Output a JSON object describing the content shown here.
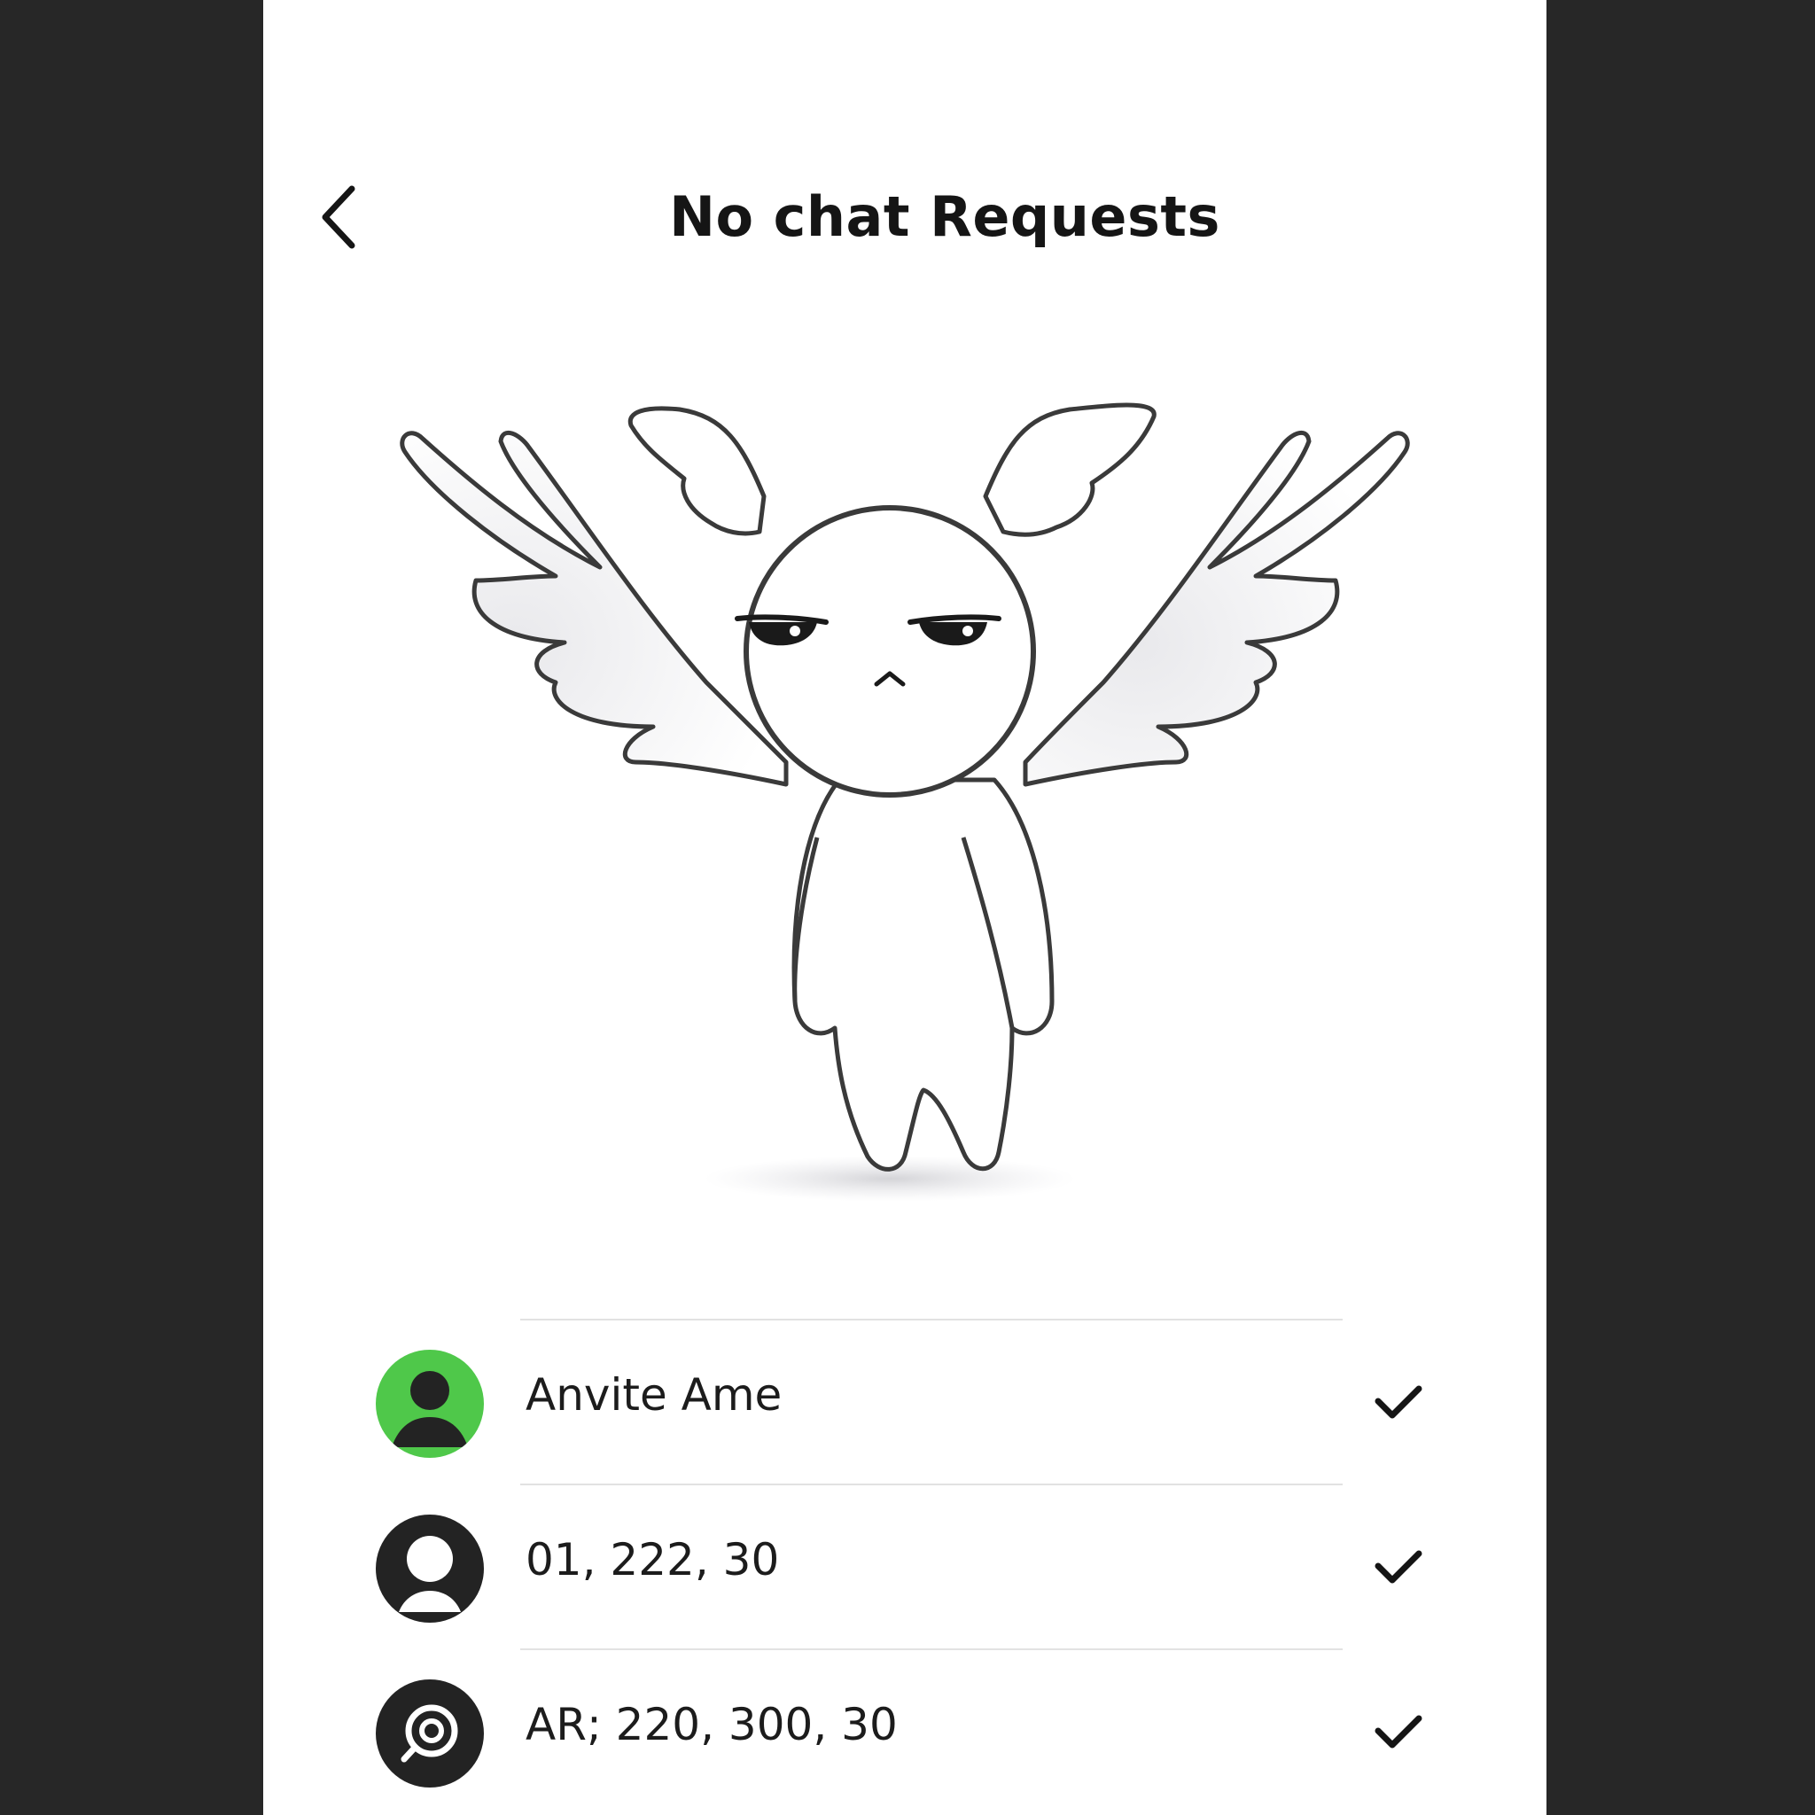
{
  "header": {
    "title": "No chat Requests",
    "back_icon": "chevron-left-icon"
  },
  "illustration": {
    "description_icon": "angel-character-icon"
  },
  "requests": [
    {
      "name": "Anvite Ame",
      "avatar_icon": "person-icon",
      "avatar_color": "#4fc84a",
      "action_icon": "check-icon"
    },
    {
      "name": "01, 222, 30",
      "avatar_icon": "person-outline-icon",
      "avatar_color": "#232323",
      "action_icon": "check-icon"
    },
    {
      "name": "AR; 220, 300, 30",
      "avatar_icon": "target-icon",
      "avatar_color": "#232323",
      "action_icon": "check-icon"
    }
  ],
  "colors": {
    "background": "#272727",
    "surface": "#ffffff",
    "accent_green": "#4fc84a",
    "text": "#151515"
  }
}
